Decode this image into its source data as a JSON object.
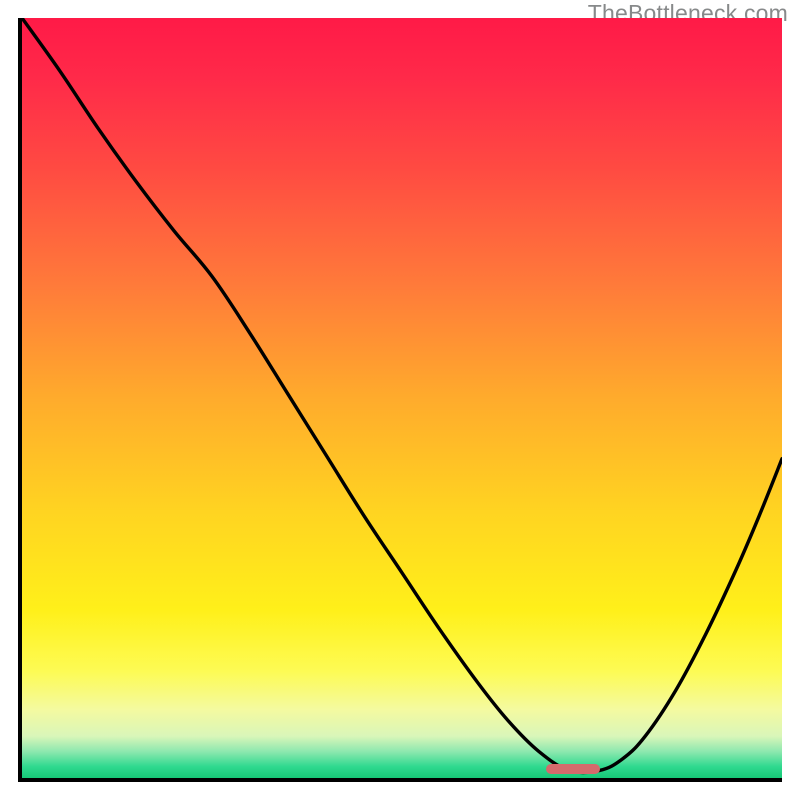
{
  "watermark": "TheBottleneck.com",
  "gradient": {
    "stops": [
      {
        "offset": 0.0,
        "color": "#ff1a47"
      },
      {
        "offset": 0.08,
        "color": "#ff2a49"
      },
      {
        "offset": 0.2,
        "color": "#ff4b42"
      },
      {
        "offset": 0.35,
        "color": "#ff7a3a"
      },
      {
        "offset": 0.5,
        "color": "#ffab2c"
      },
      {
        "offset": 0.65,
        "color": "#ffd421"
      },
      {
        "offset": 0.78,
        "color": "#fff01a"
      },
      {
        "offset": 0.86,
        "color": "#fdfb55"
      },
      {
        "offset": 0.91,
        "color": "#f4faa0"
      },
      {
        "offset": 0.945,
        "color": "#d9f6b9"
      },
      {
        "offset": 0.965,
        "color": "#8ee8af"
      },
      {
        "offset": 0.985,
        "color": "#2fd98f"
      },
      {
        "offset": 1.0,
        "color": "#17c877"
      }
    ]
  },
  "marker": {
    "color": "#d46a6c",
    "x_start": 0.69,
    "x_end": 0.76,
    "y": 0.988
  },
  "chart_data": {
    "type": "line",
    "title": "",
    "xlabel": "",
    "ylabel": "",
    "xlim": [
      0,
      1
    ],
    "ylim": [
      0,
      1
    ],
    "grid": false,
    "series": [
      {
        "name": "bottleneck-curve",
        "x": [
          0.0,
          0.05,
          0.1,
          0.15,
          0.2,
          0.25,
          0.3,
          0.35,
          0.4,
          0.45,
          0.5,
          0.55,
          0.6,
          0.64,
          0.68,
          0.72,
          0.76,
          0.79,
          0.82,
          0.86,
          0.9,
          0.94,
          0.97,
          1.0
        ],
        "y": [
          1.0,
          0.93,
          0.855,
          0.785,
          0.72,
          0.66,
          0.585,
          0.505,
          0.425,
          0.345,
          0.27,
          0.195,
          0.125,
          0.075,
          0.035,
          0.01,
          0.01,
          0.025,
          0.055,
          0.115,
          0.19,
          0.275,
          0.345,
          0.42
        ]
      }
    ],
    "bottleneck_zone": {
      "x_start": 0.69,
      "x_end": 0.76
    }
  }
}
